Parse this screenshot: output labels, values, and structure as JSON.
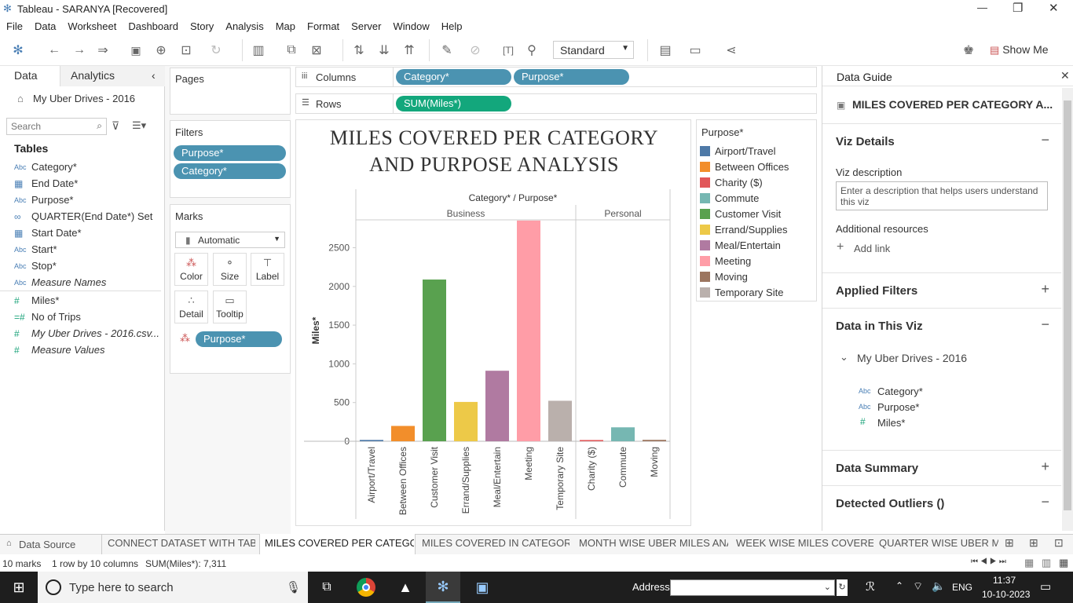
{
  "window": {
    "title": "Tableau - SARANYA [Recovered]",
    "min": "—",
    "restore": "❐",
    "close": "✕"
  },
  "menu": [
    "File",
    "Data",
    "Worksheet",
    "Dashboard",
    "Story",
    "Analysis",
    "Map",
    "Format",
    "Server",
    "Window",
    "Help"
  ],
  "toolbar": {
    "fit": "Standard",
    "show_me": "Show Me"
  },
  "left_pane": {
    "tab_data": "Data",
    "tab_analytics": "Analytics",
    "datasource": "My Uber Drives - 2016",
    "search_placeholder": "Search",
    "tables_header": "Tables",
    "fields": [
      {
        "type": "Abc",
        "name": "Category*"
      },
      {
        "type": "date",
        "name": "End Date*"
      },
      {
        "type": "Abc",
        "name": "Purpose*"
      },
      {
        "type": "set",
        "name": "QUARTER(End Date*) Set"
      },
      {
        "type": "date",
        "name": "Start Date*"
      },
      {
        "type": "Abc",
        "name": "Start*"
      },
      {
        "type": "Abc",
        "name": "Stop*"
      },
      {
        "type": "Abc",
        "name": "Measure Names"
      },
      {
        "type": "#",
        "name": "Miles*"
      },
      {
        "type": "#",
        "name": "No of Trips"
      },
      {
        "type": "#",
        "name": "My Uber Drives - 2016.csv..."
      },
      {
        "type": "#",
        "name": "Measure Values"
      }
    ]
  },
  "shelves": {
    "pages": "Pages",
    "filters": "Filters",
    "filter_pills": [
      "Purpose*",
      "Category*"
    ],
    "marks": "Marks",
    "mark_type": "Automatic",
    "mark_buttons": [
      "Color",
      "Size",
      "Label",
      "Detail",
      "Tooltip"
    ],
    "marks_pill": "Purpose*",
    "columns_label": "Columns",
    "rows_label": "Rows",
    "column_pills": [
      "Category*",
      "Purpose*"
    ],
    "row_pill": "SUM(Miles*)"
  },
  "legend": {
    "title": "Purpose*",
    "items": [
      {
        "name": "Airport/Travel",
        "color": "#4e79a7"
      },
      {
        "name": "Between Offices",
        "color": "#f28e2b"
      },
      {
        "name": "Charity ($)",
        "color": "#e15759"
      },
      {
        "name": "Commute",
        "color": "#76b7b2"
      },
      {
        "name": "Customer Visit",
        "color": "#59a14f"
      },
      {
        "name": "Errand/Supplies",
        "color": "#edc948"
      },
      {
        "name": "Meal/Entertain",
        "color": "#b07aa1"
      },
      {
        "name": "Meeting",
        "color": "#ff9da7"
      },
      {
        "name": "Moving",
        "color": "#9c755f"
      },
      {
        "name": "Temporary Site",
        "color": "#bab0ac"
      }
    ]
  },
  "chart_data": {
    "type": "bar",
    "title": "MILES COVERED PER CATEGORY AND PURPOSE ANALYSIS",
    "header": "Category* / Purpose*",
    "ylabel": "Miles*",
    "ylim": [
      0,
      2850
    ],
    "yticks": [
      0,
      500,
      1000,
      1500,
      2000,
      2500
    ],
    "groups": [
      {
        "name": "Business",
        "bars": [
          {
            "label": "Airport/Travel",
            "value": 17,
            "color": "#4e79a7"
          },
          {
            "label": "Between Offices",
            "value": 198,
            "color": "#f28e2b"
          },
          {
            "label": "Customer Visit",
            "value": 2089,
            "color": "#59a14f"
          },
          {
            "label": "Errand/Supplies",
            "value": 508,
            "color": "#edc948"
          },
          {
            "label": "Meal/Entertain",
            "value": 911,
            "color": "#b07aa1"
          },
          {
            "label": "Meeting",
            "value": 2851,
            "color": "#ff9da7"
          },
          {
            "label": "Temporary Site",
            "value": 523,
            "color": "#bab0ac"
          }
        ]
      },
      {
        "name": "Personal",
        "bars": [
          {
            "label": "Charity ($)",
            "value": 16,
            "color": "#e15759"
          },
          {
            "label": "Commute",
            "value": 180,
            "color": "#76b7b2"
          },
          {
            "label": "Moving",
            "value": 18,
            "color": "#9c755f"
          }
        ]
      }
    ]
  },
  "guide": {
    "title": "Data Guide",
    "sheet_title": "MILES COVERED PER CATEGORY A...",
    "viz_details": "Viz Details",
    "viz_description": "Viz description",
    "desc_placeholder": "Enter a description that helps users understand this viz",
    "additional": "Additional resources",
    "add_link": "Add link",
    "applied_filters": "Applied Filters",
    "data_in_viz": "Data in This Viz",
    "source": "My Uber Drives - 2016",
    "fields": [
      {
        "type": "Abc",
        "name": "Category*"
      },
      {
        "type": "Abc",
        "name": "Purpose*"
      },
      {
        "type": "#",
        "name": "Miles*"
      }
    ],
    "data_summary": "Data Summary",
    "outliers": "Detected Outliers ()"
  },
  "sheet_tabs": [
    "Data Source",
    "CONNECT DATASET WITH TAB...",
    "MILES COVERED PER CATEGO...",
    "MILES COVERED IN CATEGORY...",
    "MONTH WISE UBER MILES ANA...",
    "WEEK WISE MILES COVERED",
    "QUARTER WISE UBER MILE"
  ],
  "status": {
    "marks": "10 marks",
    "layout": "1 row by 10 columns",
    "sum": "SUM(Miles*): 7,311"
  },
  "taskbar": {
    "search": "Type here to search",
    "address": "Address",
    "lang": "ENG",
    "time": "11:37",
    "date": "10-10-2023"
  }
}
